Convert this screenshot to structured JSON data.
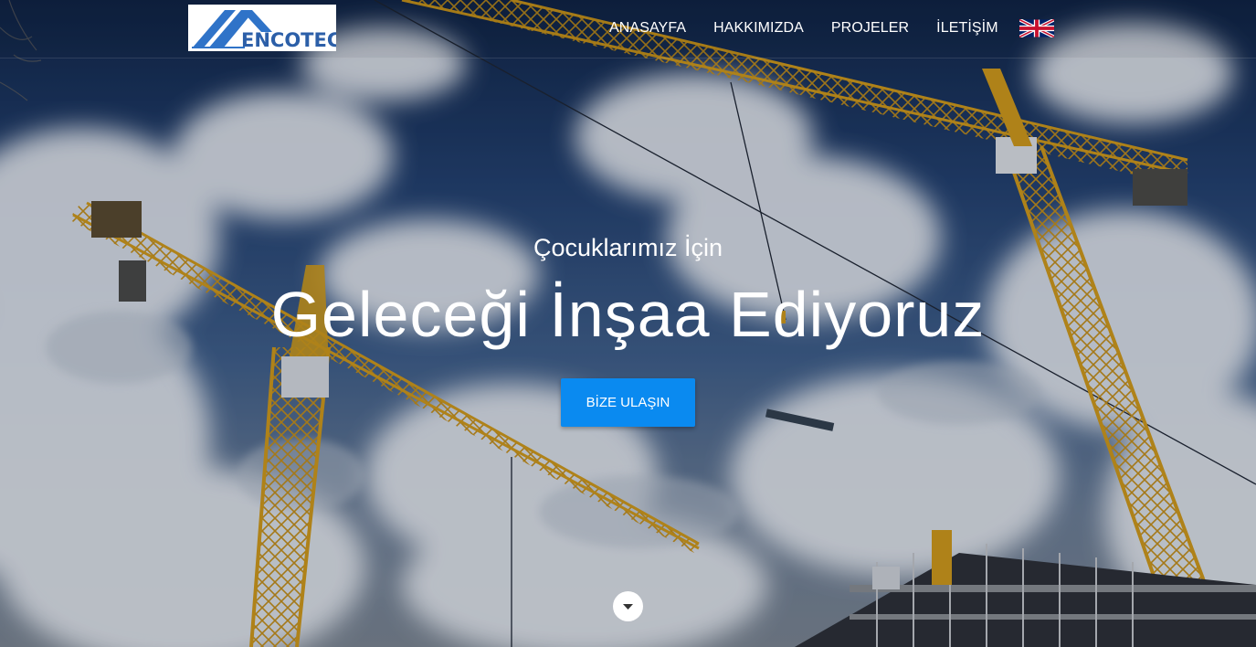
{
  "brand": {
    "name": "ENCOTECH",
    "logo_colors": {
      "blue": "#2f73c8",
      "text": "#2c5fa8"
    }
  },
  "nav": {
    "items": [
      {
        "label": "ANASAYFA"
      },
      {
        "label": "HAKKIMIZDA"
      },
      {
        "label": "PROJELER"
      },
      {
        "label": "İLETİŞİM"
      }
    ],
    "language_icon": "uk-flag-icon"
  },
  "hero": {
    "subtitle": "Çocuklarımız İçin",
    "title": "Geleceği İnşaa Ediyoruz",
    "cta_label": "BİZE ULAŞIN",
    "scroll_icon": "chevron-down-icon"
  },
  "colors": {
    "accent": "#0a8af0",
    "crane": "#d8a21c"
  }
}
